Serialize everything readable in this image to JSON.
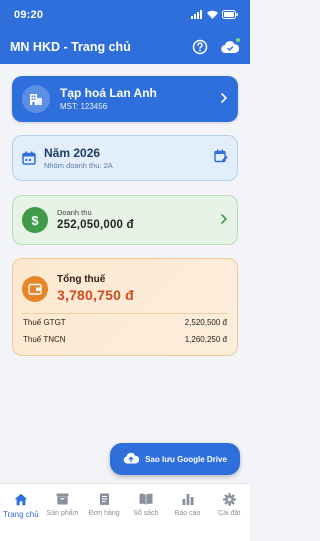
{
  "status_bar": {
    "time": "09:20"
  },
  "app_bar": {
    "title": "MN HKD - Trang chủ"
  },
  "shop": {
    "name": "Tạp hoá Lan Anh",
    "tax_code": "MST: 123456"
  },
  "year": {
    "title": "Năm 2026",
    "subtitle": "Nhóm doanh thu: 2A"
  },
  "revenue": {
    "label": "Doanh thu",
    "value": "252,050,000 đ"
  },
  "tax": {
    "label": "Tổng thuế",
    "value": "3,780,750 đ",
    "rows": [
      {
        "label": "Thuế GTGT",
        "value": "2,520,500 đ"
      },
      {
        "label": "Thuế TNCN",
        "value": "1,260,250 đ"
      }
    ]
  },
  "backup_button": {
    "label": "Sao lưu Google Drive"
  },
  "bottom_nav": {
    "items": [
      {
        "label": "Trang chủ",
        "icon": "home-icon"
      },
      {
        "label": "Sản phẩm",
        "icon": "box-icon"
      },
      {
        "label": "Đơn hàng",
        "icon": "receipt-icon"
      },
      {
        "label": "Sổ sách",
        "icon": "book-icon"
      },
      {
        "label": "Báo cáo",
        "icon": "bar-chart-icon"
      },
      {
        "label": "Cài đặt",
        "icon": "gear-icon"
      }
    ]
  },
  "colors": {
    "primary": "#2f6fdc",
    "revenue_green": "#3f9b48",
    "tax_orange": "#e8852a",
    "tax_value_red": "#d24a1f",
    "inactive_nav": "#8a919c"
  }
}
